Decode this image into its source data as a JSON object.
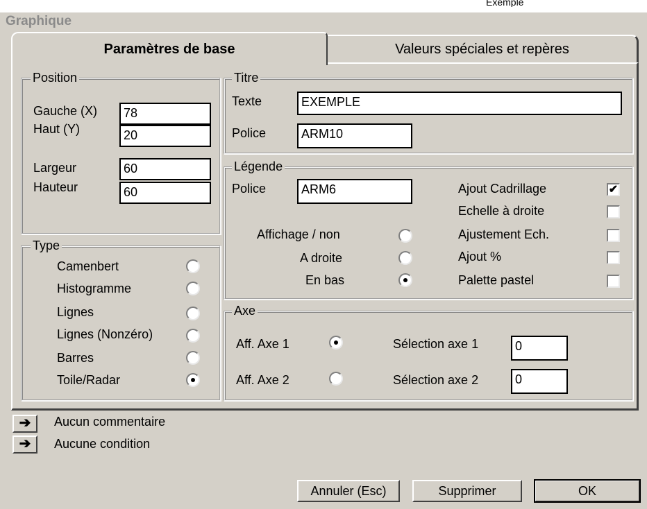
{
  "window": {
    "title": "Graphique",
    "top_clip": "Exemple"
  },
  "tabs": [
    {
      "label": "Paramètres de base"
    },
    {
      "label": "Valeurs spéciales et repères"
    }
  ],
  "position": {
    "legend": "Position",
    "gauche_label": "Gauche (X)",
    "gauche_value": "78",
    "haut_label": "Haut (Y)",
    "haut_value": "20",
    "largeur_label": "Largeur",
    "largeur_value": "60",
    "hauteur_label": "Hauteur",
    "hauteur_value": "60"
  },
  "type": {
    "legend": "Type",
    "options": [
      {
        "label": "Camenbert",
        "checked": false
      },
      {
        "label": "Histogramme",
        "checked": false
      },
      {
        "label": "Lignes",
        "checked": false
      },
      {
        "label": "Lignes (Nonzéro)",
        "checked": false
      },
      {
        "label": "Barres",
        "checked": false
      },
      {
        "label": "Toile/Radar",
        "checked": true
      }
    ]
  },
  "titre": {
    "legend": "Titre",
    "texte_label": "Texte",
    "texte_value": "EXEMPLE",
    "police_label": "Police",
    "police_value": "ARM10"
  },
  "legende": {
    "legend": "Légende",
    "police_label": "Police",
    "police_value": "ARM6",
    "display_options": [
      {
        "label": "Affichage / non",
        "checked": false
      },
      {
        "label": "A droite",
        "checked": false
      },
      {
        "label": "En bas",
        "checked": true
      }
    ],
    "checkboxes": [
      {
        "label": "Ajout Cadrillage",
        "checked": true
      },
      {
        "label": "Echelle à droite",
        "checked": false
      },
      {
        "label": "Ajustement Ech.",
        "checked": false
      },
      {
        "label": "Ajout %",
        "checked": false
      },
      {
        "label": "Palette pastel",
        "checked": false
      }
    ],
    "check_mark": "✔"
  },
  "axe": {
    "legend": "Axe",
    "axe1_label": "Aff. Axe 1",
    "axe1_checked": true,
    "axe2_label": "Aff. Axe 2",
    "axe2_checked": false,
    "sel1_label": "Sélection axe 1",
    "sel1_value": "0",
    "sel2_label": "Sélection axe 2",
    "sel2_value": "0"
  },
  "footer": {
    "arrow_glyph": "➔",
    "comment_label": "Aucun commentaire",
    "condition_label": "Aucune condition",
    "cancel_label": "Annuler (Esc)",
    "delete_label": "Supprimer",
    "ok_label": "OK"
  }
}
